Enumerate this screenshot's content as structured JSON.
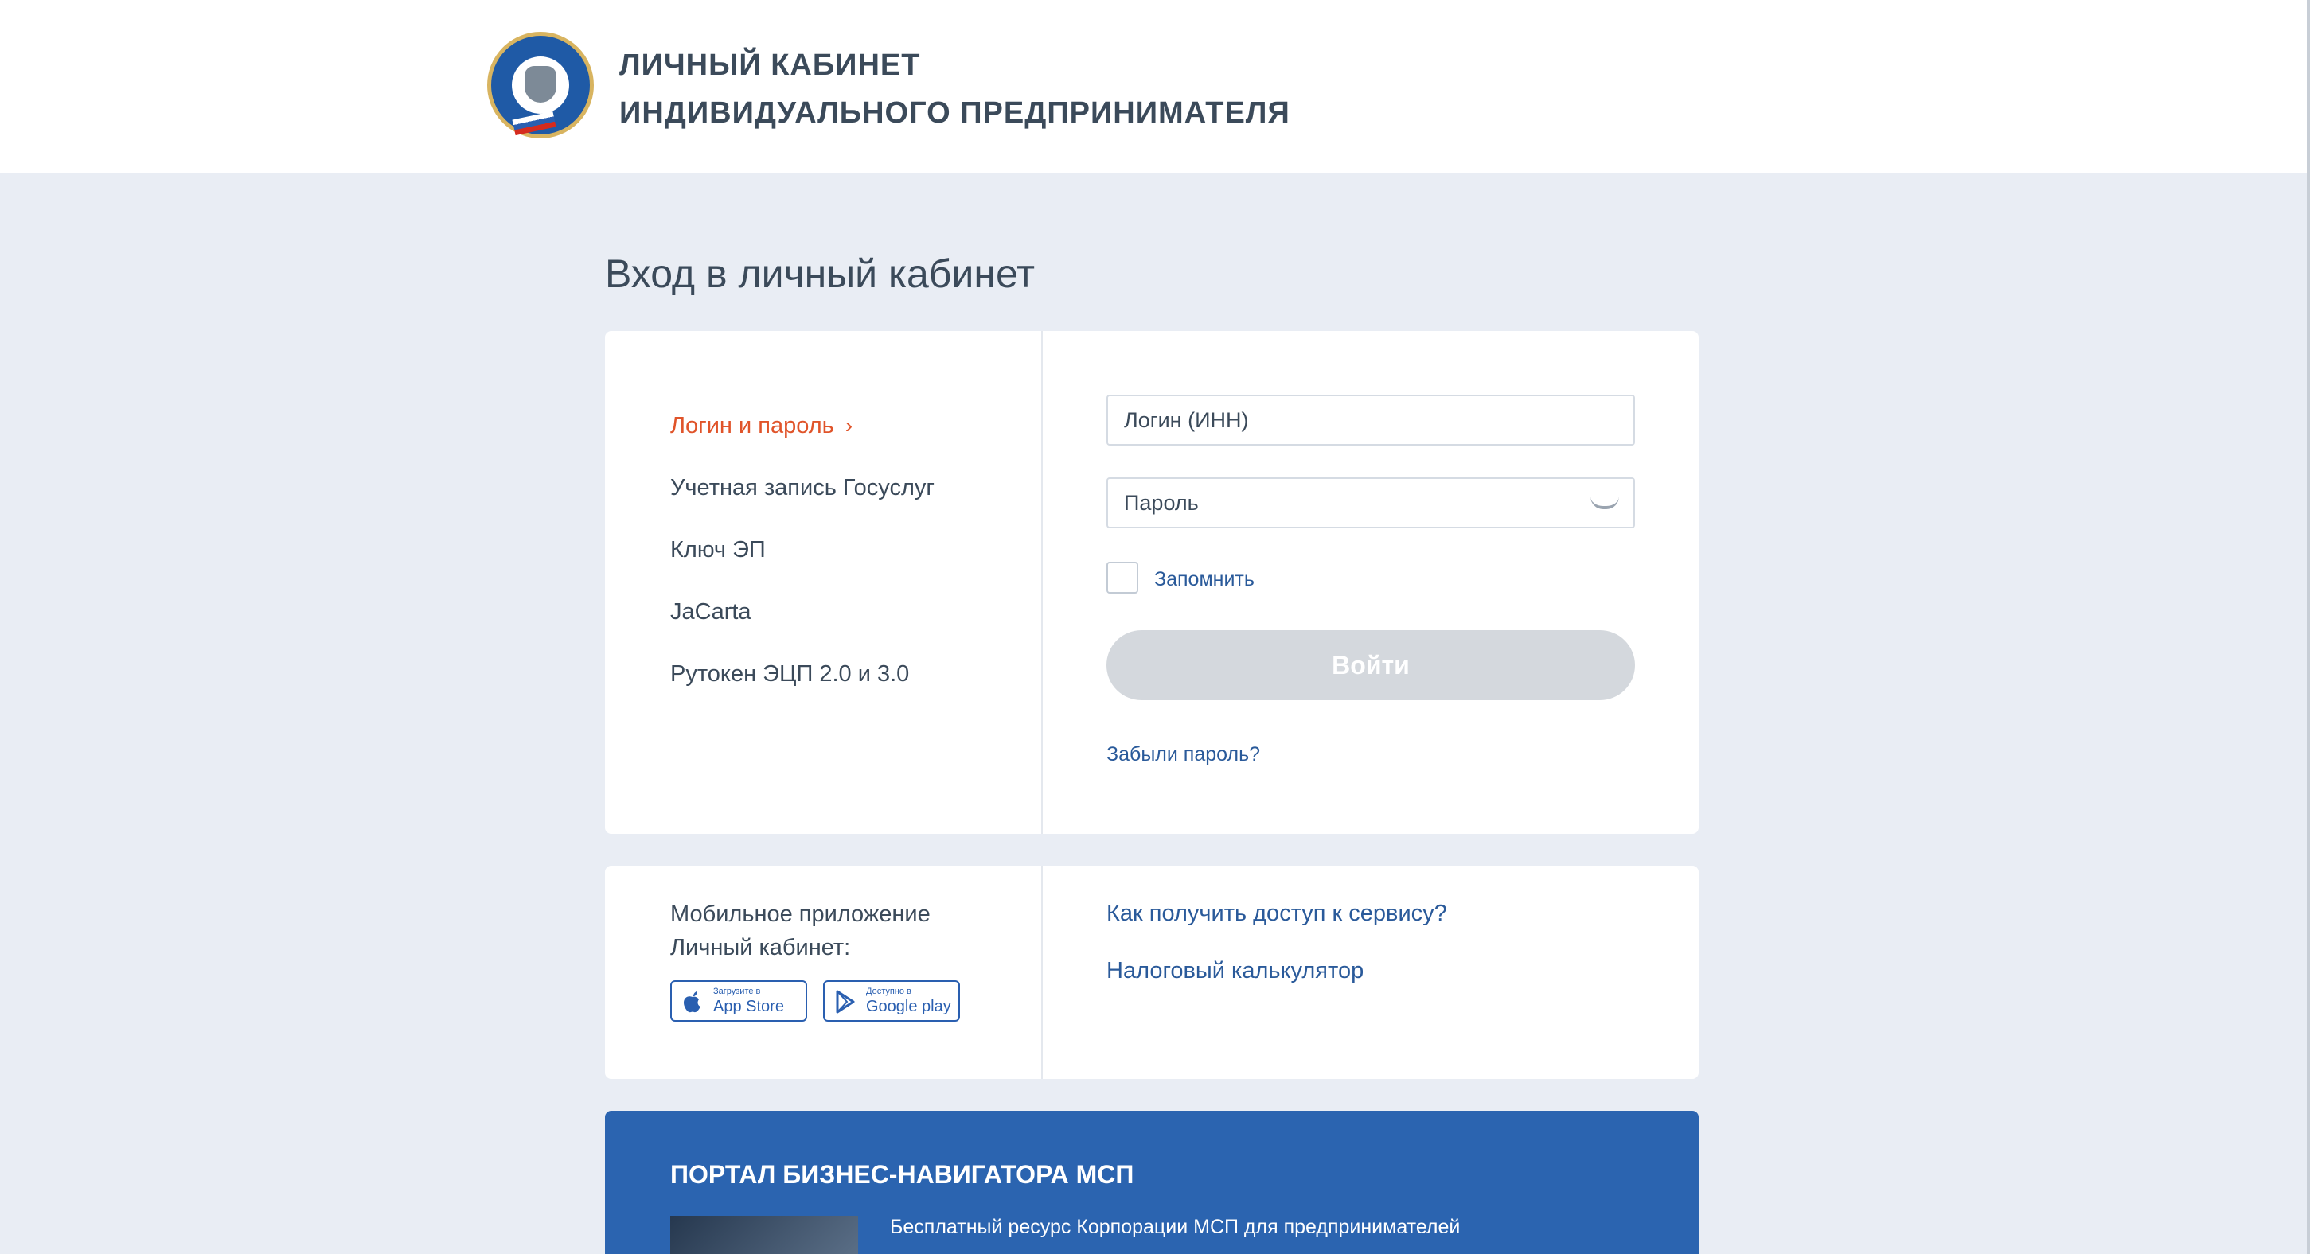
{
  "header": {
    "title_line1": "ЛИЧНЫЙ КАБИНЕТ",
    "title_line2": "ИНДИВИДУАЛЬНОГО ПРЕДПРИНИМАТЕЛЯ",
    "logo_icon": "fns-emblem-icon"
  },
  "page_title": "Вход в личный кабинет",
  "login_methods": [
    {
      "label": "Логин и пароль",
      "active": true
    },
    {
      "label": "Учетная запись Госуслуг",
      "active": false
    },
    {
      "label": "Ключ ЭП",
      "active": false
    },
    {
      "label": "JaCarta",
      "active": false
    },
    {
      "label": "Рутокен ЭЦП 2.0 и 3.0",
      "active": false
    }
  ],
  "form": {
    "login_placeholder": "Логин (ИНН)",
    "password_placeholder": "Пароль",
    "remember_label": "Запомнить",
    "submit_label": "Войти",
    "forgot_link": "Забыли пароль?"
  },
  "mobile": {
    "text_line1": "Мобильное приложение",
    "text_line2": "Личный кабинет:",
    "appstore_small": "Загрузите в",
    "appstore_big": "App Store",
    "google_small": "Доступно в",
    "google_big": "Google play"
  },
  "links": {
    "access": "Как получить доступ к сервису?",
    "calculator": "Налоговый калькулятор"
  },
  "banner": {
    "title": "ПОРТАЛ БИЗНЕС-НАВИГАТОРА МСП",
    "text": "Бесплатный ресурс Корпорации МСП для предпринимателей"
  },
  "colors": {
    "accent_orange": "#e0542a",
    "link_blue": "#2a5a9a",
    "banner_blue": "#2b64b0",
    "disabled_button": "#d4d8dd"
  }
}
